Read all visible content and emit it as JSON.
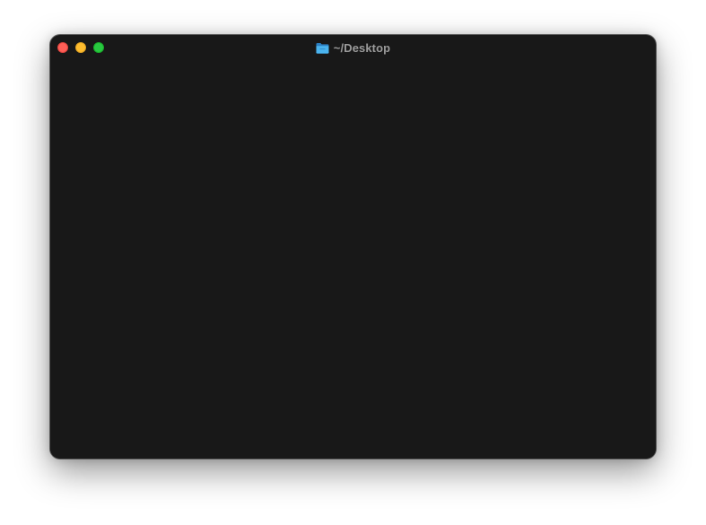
{
  "window": {
    "title": "~/Desktop",
    "title_icon": "folder-icon",
    "background": "#181818"
  },
  "traffic_lights": {
    "close": "#fe5f57",
    "minimize": "#febc2e",
    "zoom": "#28c840"
  },
  "terminal": {
    "content": ""
  }
}
